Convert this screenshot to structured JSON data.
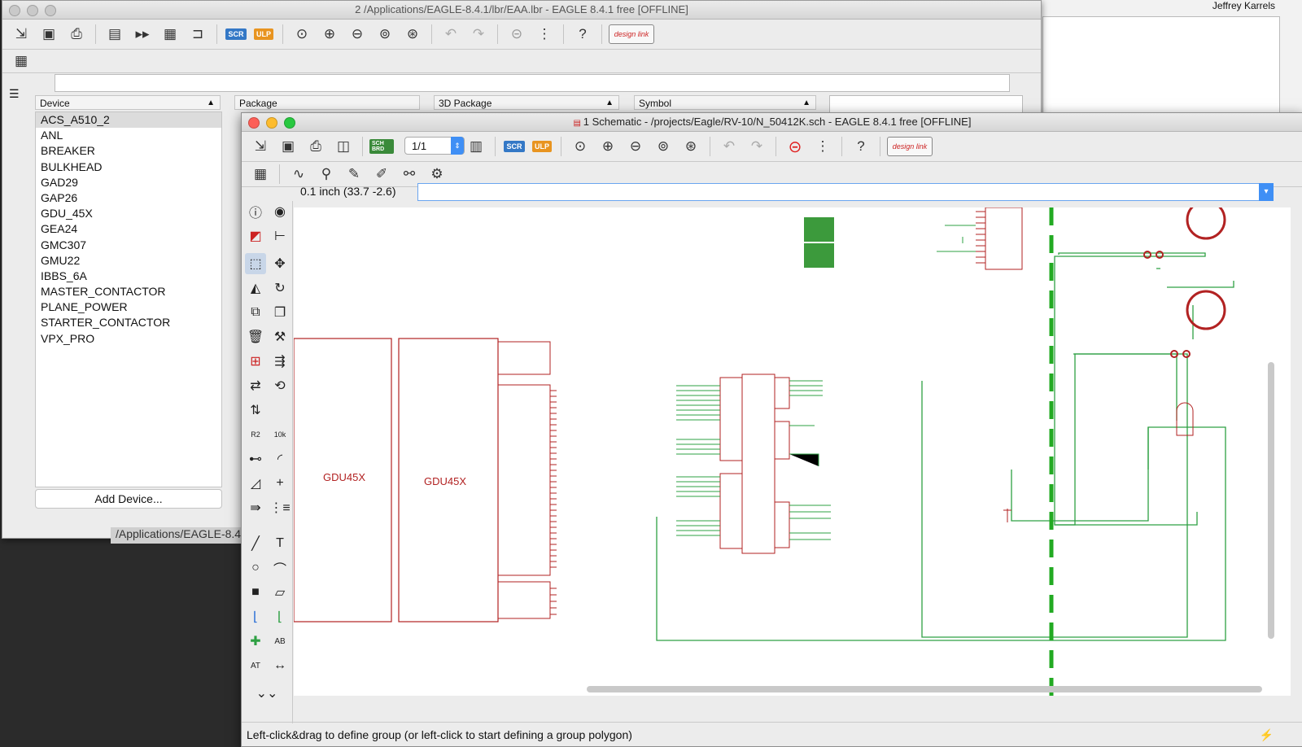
{
  "background_window": {
    "user_name": "Jeffrey Karrels"
  },
  "library_window": {
    "title": "2 /Applications/EAGLE-8.4.1/lbr/EAA.lbr - EAGLE 8.4.1 free [OFFLINE]",
    "columns": {
      "device": "Device",
      "package": "Package",
      "package_3d": "3D Package",
      "symbol": "Symbol"
    },
    "devices": [
      "ACS_A510_2",
      "ANL",
      "BREAKER",
      "BULKHEAD",
      "GAD29",
      "GAP26",
      "GDU_45X",
      "GEA24",
      "GMC307",
      "GMU22",
      "IBBS_6A",
      "MASTER_CONTACTOR",
      "PLANE_POWER",
      "STARTER_CONTACTOR",
      "VPX_PRO"
    ],
    "selected_device": "ACS_A510_2",
    "add_device_button": "Add Device...",
    "behind_path_fragment": "/Applications/EAGLE-8.4"
  },
  "schematic_window": {
    "title": "1 Schematic - /projects/Eagle/RV-10/N_50412K.sch - EAGLE 8.4.1 free [OFFLINE]",
    "sheet_selector": "1/1",
    "grid_readout": "0.1 inch (33.7 -2.6)",
    "command_value": "",
    "status_text": "Left-click&drag to define group (or left-click to start defining a group polygon)",
    "badges": {
      "sch_brd": "SCH BRD",
      "scr": "SCR",
      "ulp": "ULP",
      "design_link": "design link"
    },
    "canvas_labels": {
      "gdu_left": "GDU45X",
      "gdu_right": "GDU45X"
    }
  },
  "colors": {
    "wire_green": "#2ea043",
    "part_red": "#b22222",
    "bus_green": "#22aa22",
    "accent_blue": "#4a8fe7",
    "title_gray": "#555555"
  },
  "icons": [
    "new-icon",
    "save-icon",
    "print-icon",
    "library-icon",
    "zoom-in-icon",
    "zoom-out-icon",
    "undo-icon",
    "redo-icon",
    "stop-icon",
    "help-icon",
    "grid-icon",
    "info-icon",
    "eye-icon",
    "move-icon",
    "rotate-icon",
    "copy-icon",
    "delete-icon",
    "wrench-icon",
    "text-icon",
    "circle-icon",
    "gear-icon"
  ]
}
